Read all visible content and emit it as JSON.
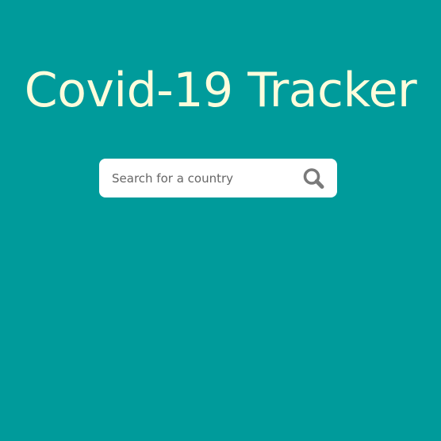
{
  "app": {
    "title": "Covid-19 Tracker"
  },
  "search": {
    "placeholder": "Search for a country",
    "value": "",
    "icon": "search-icon"
  },
  "colors": {
    "background": "#009B9B",
    "title": "#FDFCDC",
    "search_box": "#FFFFFF",
    "icon": "#7A7A7A"
  }
}
